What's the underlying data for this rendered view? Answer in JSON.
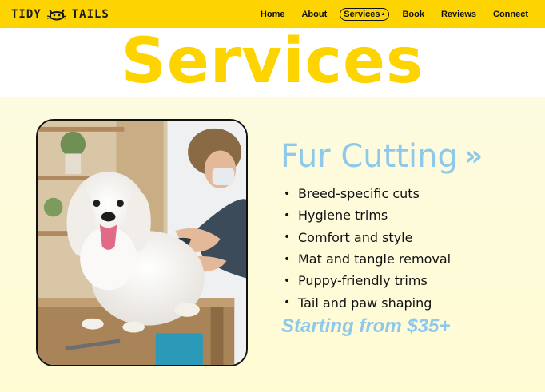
{
  "brand": {
    "name_left": "TIDY",
    "name_right": "TAILS",
    "logo_icon": "cat-face-icon",
    "color": "#fdd400"
  },
  "nav": {
    "items": [
      {
        "label": "Home",
        "active": false
      },
      {
        "label": "About",
        "active": false
      },
      {
        "label": "Services",
        "active": true,
        "caret": "▲"
      },
      {
        "label": "Book",
        "active": false
      },
      {
        "label": "Reviews",
        "active": false
      },
      {
        "label": "Connect",
        "active": false
      }
    ]
  },
  "page": {
    "title": "Services",
    "title_color": "#fdd400"
  },
  "service": {
    "title": "Fur Cutting",
    "arrow": "»",
    "accent_color": "#8ec9ec",
    "features": [
      "Breed-specific cuts",
      "Hygiene trims",
      "Comfort and style",
      "Mat and tangle removal",
      "Puppy-friendly trims",
      "Tail and paw shaping"
    ],
    "bullet": "•",
    "price": "Starting from $35+"
  },
  "image": {
    "subject": "groomer-trimming-white-dog-photo"
  }
}
